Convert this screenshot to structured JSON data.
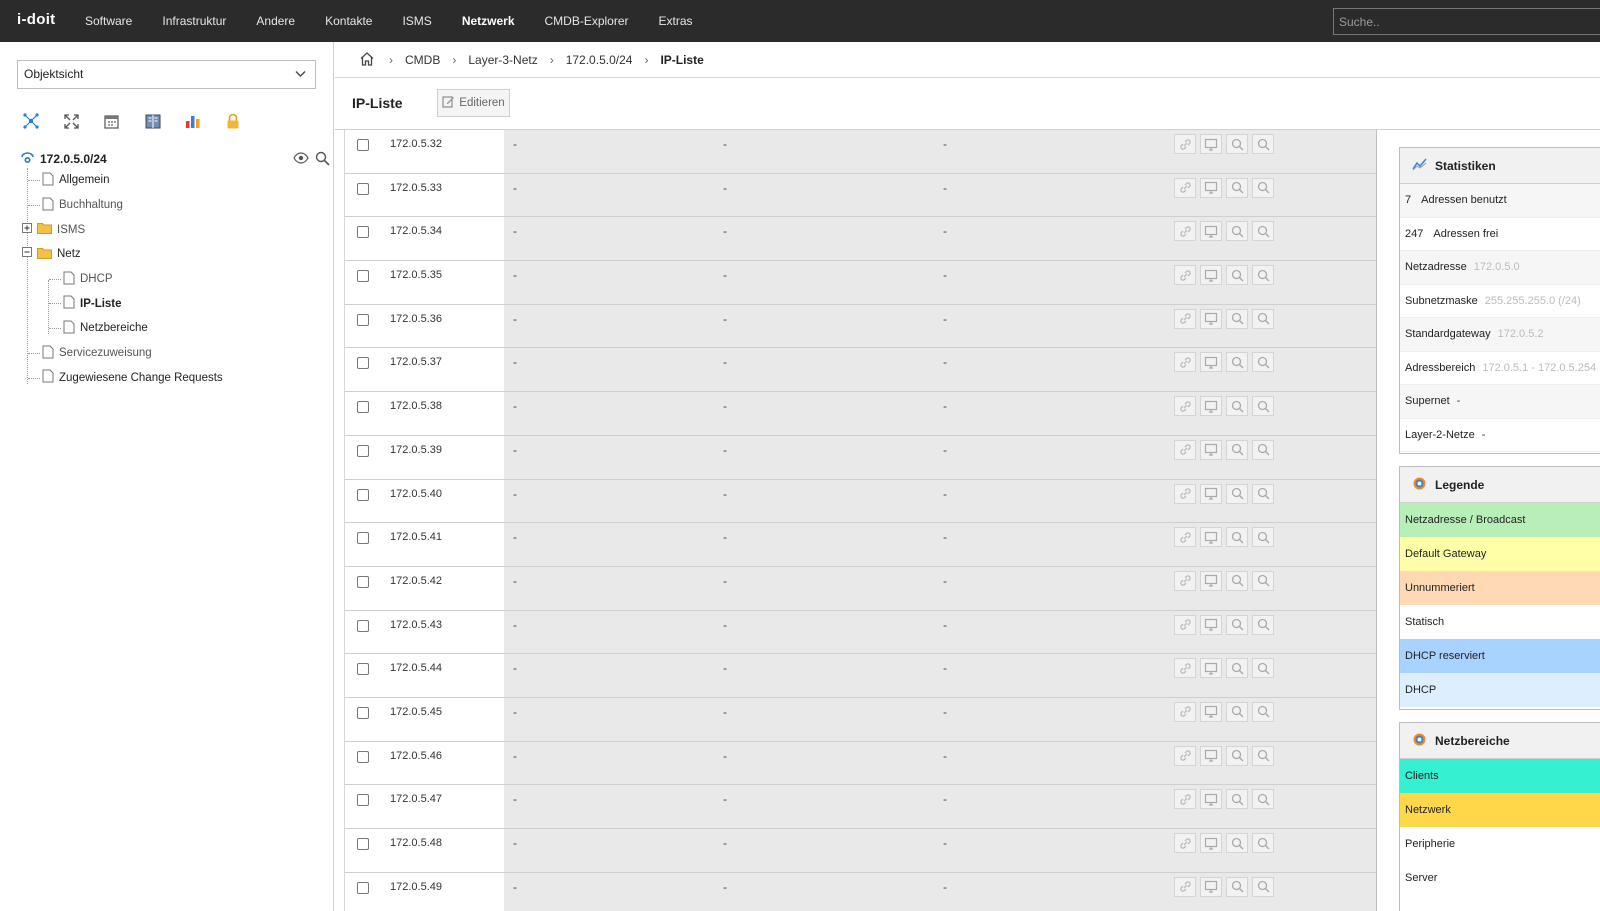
{
  "app": {
    "logo": "i-doit"
  },
  "nav": {
    "items": [
      {
        "label": "Software"
      },
      {
        "label": "Infrastruktur"
      },
      {
        "label": "Andere"
      },
      {
        "label": "Kontakte"
      },
      {
        "label": "ISMS"
      },
      {
        "label": "Netzwerk"
      },
      {
        "label": "CMDB-Explorer"
      },
      {
        "label": "Extras"
      }
    ],
    "active": "Netzwerk"
  },
  "search": {
    "placeholder": "Suche.."
  },
  "sidebar": {
    "view_select": "Objektsicht",
    "icons": [
      "network-icon",
      "expand-icon",
      "calendar-icon",
      "book-icon",
      "chart-icon",
      "lock-icon"
    ],
    "tree": {
      "root": "172.0.5.0/24",
      "items": [
        {
          "label": "Allgemein"
        },
        {
          "label": "Buchhaltung"
        },
        {
          "label": "ISMS"
        },
        {
          "label": "Netz"
        },
        {
          "label": "DHCP"
        },
        {
          "label": "IP-Liste"
        },
        {
          "label": "Netzbereiche"
        },
        {
          "label": "Servicezuweisung"
        },
        {
          "label": "Zugewiesene Change Requests"
        }
      ]
    }
  },
  "breadcrumb": {
    "items": [
      "CMDB",
      "Layer-3-Netz",
      "172.0.5.0/24"
    ],
    "current": "IP-Liste"
  },
  "page": {
    "title": "IP-Liste",
    "edit_label": "Editieren"
  },
  "ip_rows": [
    {
      "ip": "172.0.5.32",
      "c1": "-",
      "c2": "-",
      "c3": "-"
    },
    {
      "ip": "172.0.5.33",
      "c1": "-",
      "c2": "-",
      "c3": "-"
    },
    {
      "ip": "172.0.5.34",
      "c1": "-",
      "c2": "-",
      "c3": "-"
    },
    {
      "ip": "172.0.5.35",
      "c1": "-",
      "c2": "-",
      "c3": "-"
    },
    {
      "ip": "172.0.5.36",
      "c1": "-",
      "c2": "-",
      "c3": "-"
    },
    {
      "ip": "172.0.5.37",
      "c1": "-",
      "c2": "-",
      "c3": "-"
    },
    {
      "ip": "172.0.5.38",
      "c1": "-",
      "c2": "-",
      "c3": "-"
    },
    {
      "ip": "172.0.5.39",
      "c1": "-",
      "c2": "-",
      "c3": "-"
    },
    {
      "ip": "172.0.5.40",
      "c1": "-",
      "c2": "-",
      "c3": "-"
    },
    {
      "ip": "172.0.5.41",
      "c1": "-",
      "c2": "-",
      "c3": "-"
    },
    {
      "ip": "172.0.5.42",
      "c1": "-",
      "c2": "-",
      "c3": "-"
    },
    {
      "ip": "172.0.5.43",
      "c1": "-",
      "c2": "-",
      "c3": "-"
    },
    {
      "ip": "172.0.5.44",
      "c1": "-",
      "c2": "-",
      "c3": "-"
    },
    {
      "ip": "172.0.5.45",
      "c1": "-",
      "c2": "-",
      "c3": "-"
    },
    {
      "ip": "172.0.5.46",
      "c1": "-",
      "c2": "-",
      "c3": "-"
    },
    {
      "ip": "172.0.5.47",
      "c1": "-",
      "c2": "-",
      "c3": "-"
    },
    {
      "ip": "172.0.5.48",
      "c1": "-",
      "c2": "-",
      "c3": "-"
    },
    {
      "ip": "172.0.5.49",
      "c1": "-",
      "c2": "-",
      "c3": "-"
    }
  ],
  "row_actions": [
    "link-icon",
    "monitor-icon",
    "search-icon",
    "search-icon"
  ],
  "statistics": {
    "title": "Statistiken",
    "used_count": "7",
    "used_label": "Adressen benutzt",
    "free_count": "247",
    "free_label": "Adressen frei",
    "rows": [
      {
        "label": "Netzadresse",
        "value": "172.0.5.0"
      },
      {
        "label": "Subnetzmaske",
        "value": "255.255.255.0 (/24)"
      },
      {
        "label": "Standardgateway",
        "value": "172.0.5.2"
      },
      {
        "label": "Adressbereich",
        "value": "172.0.5.1 - 172.0.5.254"
      },
      {
        "label": "Supernet",
        "value": "-"
      },
      {
        "label": "Layer-2-Netze",
        "value": "-"
      }
    ]
  },
  "legend": {
    "title": "Legende",
    "items": [
      {
        "label": "Netzadresse / Broadcast",
        "color": "#b8eeb8"
      },
      {
        "label": "Default Gateway",
        "color": "#ffffa8"
      },
      {
        "label": "Unnummeriert",
        "color": "#ffd9b3"
      },
      {
        "label": "Statisch",
        "color": "#ffffff"
      },
      {
        "label": "DHCP reserviert",
        "color": "#a8d2ff"
      },
      {
        "label": "DHCP",
        "color": "#dceeff"
      }
    ]
  },
  "ranges": {
    "title": "Netzbereiche",
    "items": [
      {
        "label": "Clients",
        "color": "#36f0d2"
      },
      {
        "label": "Netzwerk",
        "color": "#ffd84a"
      },
      {
        "label": "Peripherie",
        "color": "#ffffff"
      },
      {
        "label": "Server",
        "color": "#ffffff"
      }
    ]
  }
}
